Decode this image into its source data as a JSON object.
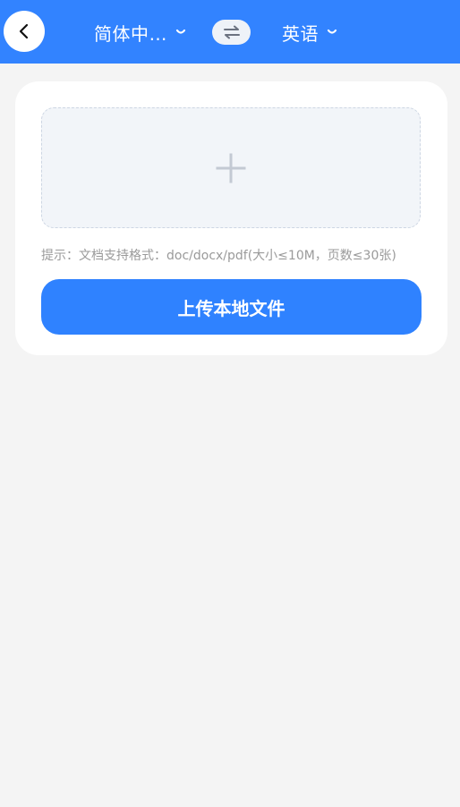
{
  "header": {
    "back_icon": "chevron-left-icon",
    "source_language": "简体中…",
    "target_language": "英语",
    "dropdown_icon": "chevron-down-icon",
    "swap_icon": "swap-arrows-icon",
    "background_color": "#3283ff"
  },
  "upload_card": {
    "dropzone_icon": "plus-icon",
    "hint": "提示：文档支持格式：doc/docx/pdf(大小≤10M，页数≤30张)",
    "upload_button_label": "上传本地文件",
    "button_color": "#2f82ff"
  }
}
